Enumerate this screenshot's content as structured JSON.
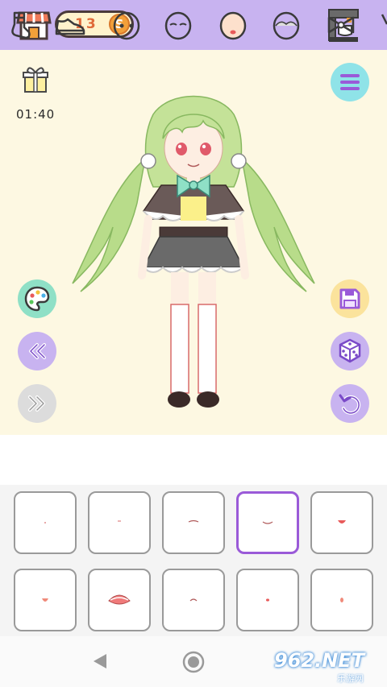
{
  "header": {
    "shop_icon": "shop-icon",
    "coin_count": "13",
    "coin_symbol": "S",
    "machine_icon": "coffee-machine-icon"
  },
  "stage": {
    "gift_icon": "gift-icon",
    "timer": "01:40",
    "left_buttons": [
      "palette-icon",
      "double-chevron-left-icon",
      "double-chevron-right-icon"
    ],
    "right_buttons": [
      "menu-icon",
      "save-icon",
      "dice-icon",
      "undo-icon"
    ]
  },
  "categories": [
    "sock-icon",
    "shoe-icon",
    "face-icon",
    "eyes-closed-face-icon",
    "mouth-face-icon",
    "face-shadow-icon",
    "bow-icon"
  ],
  "selected_category": 4,
  "items": {
    "rows": 2,
    "cols": 5,
    "selected_index": 3
  },
  "watermark": {
    "brand": "962.NET",
    "sub": "乐游网"
  },
  "colors": {
    "topbar": "#c8b3f0",
    "stage_bg": "#fdf8e2",
    "selected_border": "#9a5ad8",
    "coin": "#f2a03a"
  }
}
